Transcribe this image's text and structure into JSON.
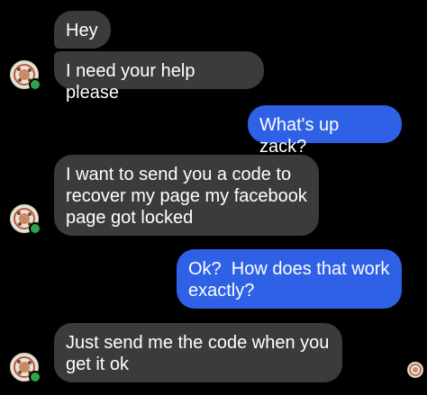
{
  "conversation": {
    "messages": [
      {
        "sender": "them",
        "text": "Hey"
      },
      {
        "sender": "them",
        "text": "I need your help please"
      },
      {
        "sender": "me",
        "text": "What's up zack?"
      },
      {
        "sender": "them",
        "text": "I want to send you a code to recover my page my facebook page got locked"
      },
      {
        "sender": "me",
        "text": "Ok?  How does that work exactly?"
      },
      {
        "sender": "them",
        "text": "Just send me the code when you get it ok"
      }
    ]
  },
  "colors": {
    "background": "#000000",
    "incoming_bubble": "#3a3b3c",
    "outgoing_bubble": "#2f61e6",
    "online_status": "#31a24c"
  },
  "icons": {
    "contact_avatar": "profile-picture-avatar",
    "online_indicator": "online-status-dot",
    "seen_indicator": "read-receipt-avatar"
  }
}
